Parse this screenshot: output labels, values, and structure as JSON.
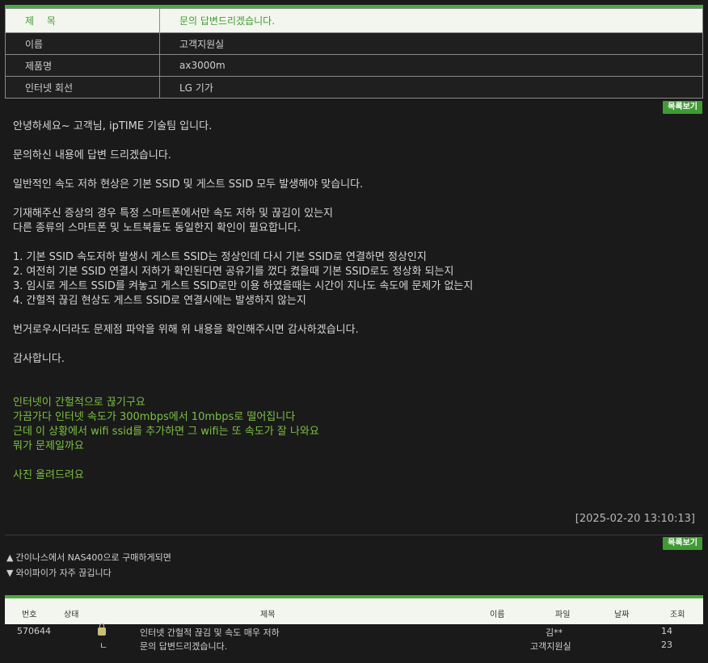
{
  "info": {
    "title_label": "제 목",
    "title_value": "문의 답변드리겠습니다.",
    "rows": [
      {
        "label": "이름",
        "value": "고객지원실"
      },
      {
        "label": "제품명",
        "value": "ax3000m"
      },
      {
        "label": "인터넷 회선",
        "value": "LG 기가"
      }
    ]
  },
  "list_button": "목록보기",
  "body_lines": [
    "안녕하세요~ 고객님, ipTIME 기술팀 입니다.",
    "",
    "문의하신 내용에 답변 드리겠습니다.",
    "",
    "일반적인 속도 저하 현상은 기본 SSID 및 게스트 SSID 모두 발생해야 맞습니다.",
    "",
    "기재해주신 증상의 경우 특정 스마트폰에서만 속도 저하 및 끊김이 있는지",
    "다른 종류의 스마트폰 및 노트북들도 동일한지 확인이 필요합니다.",
    "",
    "1. 기본 SSID 속도저하 발생시 게스트 SSID는 정상인데 다시 기본 SSID로 연결하면 정상인지",
    "2. 여전히 기본 SSID 연결시 저하가 확인된다면 공유기를 껐다 켰을때 기본 SSID로도 정상화 되는지",
    "3. 임시로 게스트 SSID를 켜놓고 게스트 SSID로만 이용 하였을때는 시간이 지나도 속도에 문제가 없는지",
    "4. 간헐적 끊김 현상도 게스트 SSID로 연결시에는 발생하지 않는지",
    "",
    "번거로우시더라도 문제점 파악을 위해 위 내용을 확인해주시면 감사하겠습니다.",
    "",
    "감사합니다."
  ],
  "quote_lines": [
    "인터넷이 간헐적으로 끊기구요",
    "가끔가다 인터넷 속도가 300mbps에서 10mbps로 떨어집니다",
    "근데 이 상황에서 wifi ssid를 추가하면 그 wifi는 또 속도가 잘 나와요",
    "뭐가 문제일까요",
    "",
    "사진 올려드려요"
  ],
  "timestamp": "[2025-02-20 13:10:13]",
  "nav": {
    "prev_arrow": "▲",
    "prev_text": "간이나스에서 NAS400으로 구매하게되면",
    "next_arrow": "▼",
    "next_text": "와이파이가 자주 끊깁니다"
  },
  "table": {
    "headers": {
      "no": "번호",
      "status": "상태",
      "title": "제목",
      "name": "이름",
      "file": "파일",
      "date": "날짜",
      "views": "조회"
    },
    "rows": [
      {
        "no": "570644",
        "status_icon": "lock-icon",
        "title": "인터넷 간헐적 끊김 및 속도 매우 저하",
        "name": "김**",
        "views": "14"
      },
      {
        "no": "",
        "status_icon": "reply-icon",
        "status_glyph": "ㄴ",
        "title": "문의 답변드리겠습니다.",
        "name": "고객지원실",
        "views": "23"
      }
    ]
  },
  "colors": {
    "accent": "#4aab3c",
    "quote": "#7cc043",
    "background": "#1a1a1a"
  }
}
